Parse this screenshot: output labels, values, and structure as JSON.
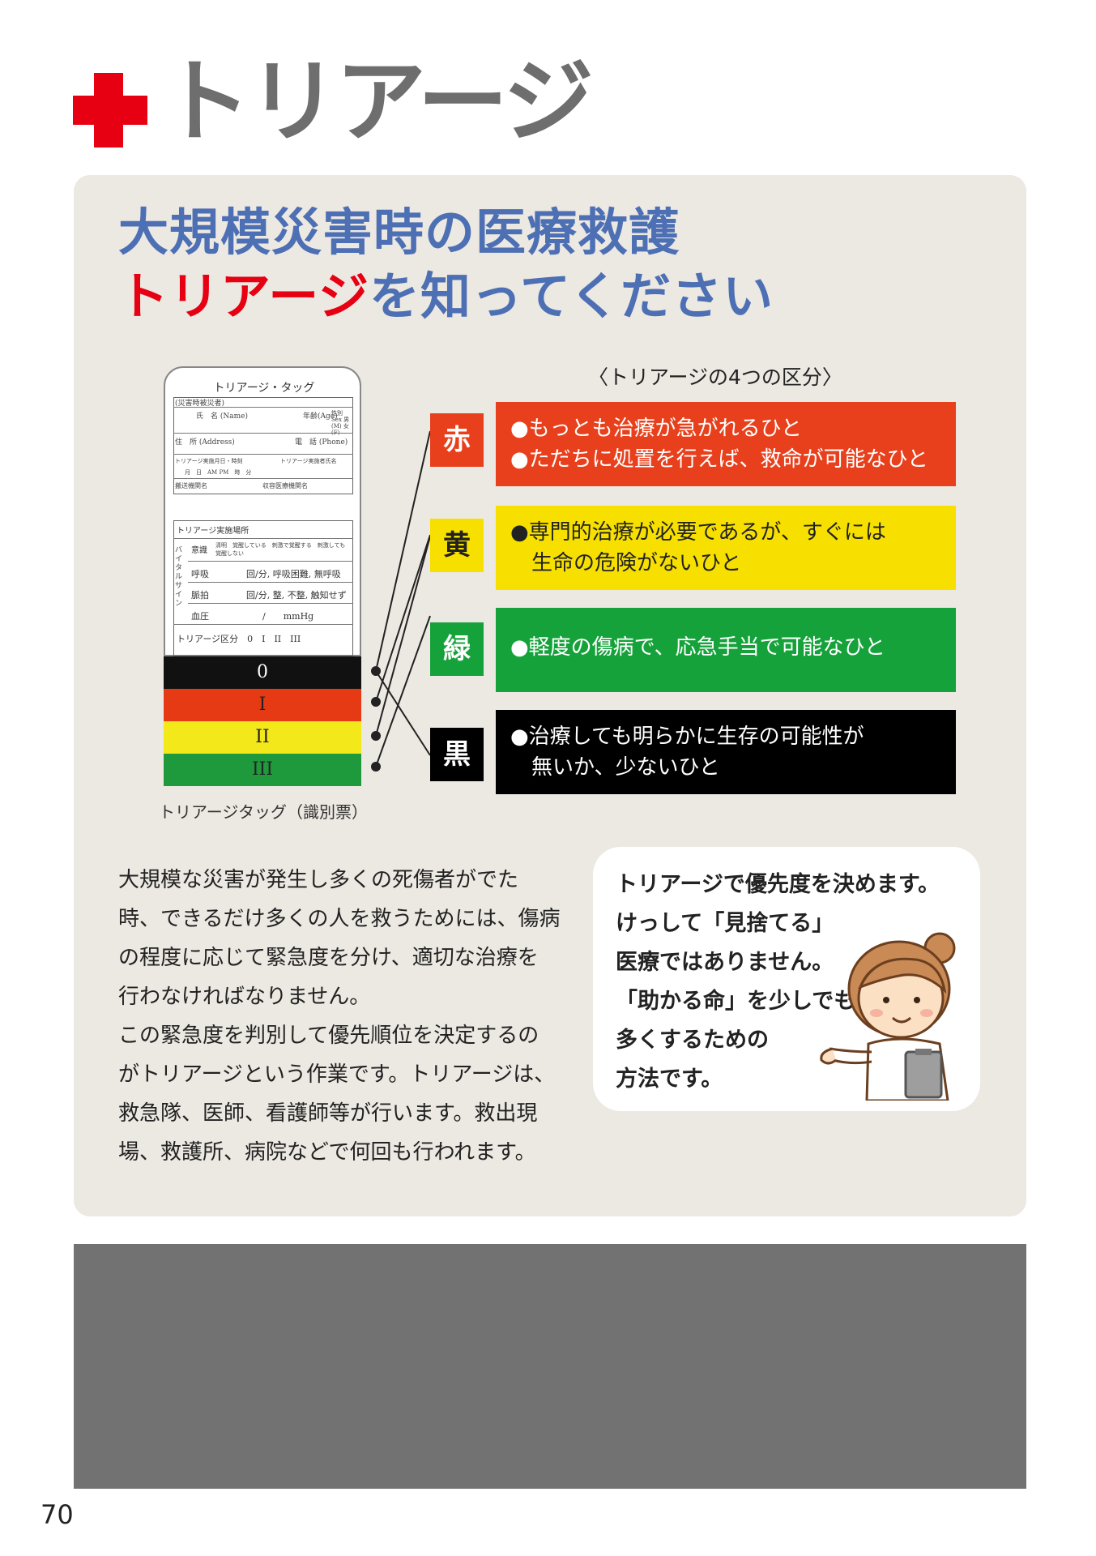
{
  "header": {
    "title": "トリアージ"
  },
  "headline": {
    "line1": "大規模災害時の医療救護",
    "line2_red": "トリアージ",
    "line2_rest": "を知ってください"
  },
  "categories_caption": "〈トリアージの4つの区分〉",
  "categories": [
    {
      "label": "赤",
      "color": "#e8401c",
      "lines": [
        "●もっとも治療が急がれるひと",
        "●ただちに処置を行えば、救命が可能なひと"
      ]
    },
    {
      "label": "黄",
      "color": "#f7e000",
      "lines": [
        "●専門的治療が必要であるが、すぐには",
        "　生命の危険がないひと"
      ]
    },
    {
      "label": "緑",
      "color": "#16a23a",
      "lines": [
        "●軽度の傷病で、応急手当で可能なひと"
      ]
    },
    {
      "label": "黒",
      "color": "#000000",
      "lines": [
        "●治療しても明らかに生存の可能性が",
        "　無いか、少ないひと"
      ]
    }
  ],
  "tag": {
    "title": "トリアージ・タッグ",
    "header_small": "(災害時被災者)",
    "name_label": "氏　名 (Name)",
    "age_label": "年齢(Age)",
    "sex_label": "性別 Sex 男(M) 女(F)",
    "address_label": "住　所 (Address)",
    "phone_label": "電　話 (Phone)",
    "datetime_label": "トリアージ実施月日・時刻",
    "executor_label": "トリアージ実施者氏名",
    "date_row": "月　日　AM PM　時　分",
    "transport_label": "搬送機関名",
    "hospital_label": "収容医療機関名",
    "place_label": "トリアージ実施場所",
    "vital_label": "バイタルサイン",
    "vitals": [
      {
        "name": "意識",
        "value": "清明　覚醒している　刺激で覚醒する　刺激しても覚醒しない"
      },
      {
        "name": "呼吸",
        "value": "回/分, 呼吸困難, 無呼吸"
      },
      {
        "name": "脈拍",
        "value": "回/分, 整, 不整, 触知せず"
      },
      {
        "name": "血圧",
        "value": "/　　mmHg"
      }
    ],
    "category_row": "トリアージ区分　0　I　II　III",
    "stripes": [
      {
        "label": "0",
        "color": "#111111",
        "text_color": "#ffffff"
      },
      {
        "label": "I",
        "color": "#e63a14",
        "text_color": "#222222"
      },
      {
        "label": "II",
        "color": "#f3e81a",
        "text_color": "#222222"
      },
      {
        "label": "III",
        "color": "#1e9a3c",
        "text_color": "#222222"
      }
    ],
    "caption": "トリアージタッグ（識別票）"
  },
  "body": {
    "lines": [
      "大規模な災害が発生し多くの死傷者がでた",
      "時、できるだけ多くの人を救うためには、傷病",
      "の程度に応じて緊急度を分け、適切な治療を",
      "行わなければなりません。",
      "この緊急度を判別して優先順位を決定するの",
      "がトリアージという作業です。トリアージは、",
      "救急隊、医師、看護師等が行います。救出現",
      "場、救護所、病院などで何回も行われます。"
    ]
  },
  "bubble": {
    "lines": [
      "トリアージで優先度を決めます。",
      "けっして「見捨てる」",
      "医療ではありません。",
      "「助かる命」を少しでも",
      "多くするための",
      "方法です。"
    ]
  },
  "page_number": "70",
  "colors": {
    "red": "#e60012",
    "blue": "#4d6fb4",
    "panel": "#ece8e2",
    "gray_block": "#727272"
  }
}
